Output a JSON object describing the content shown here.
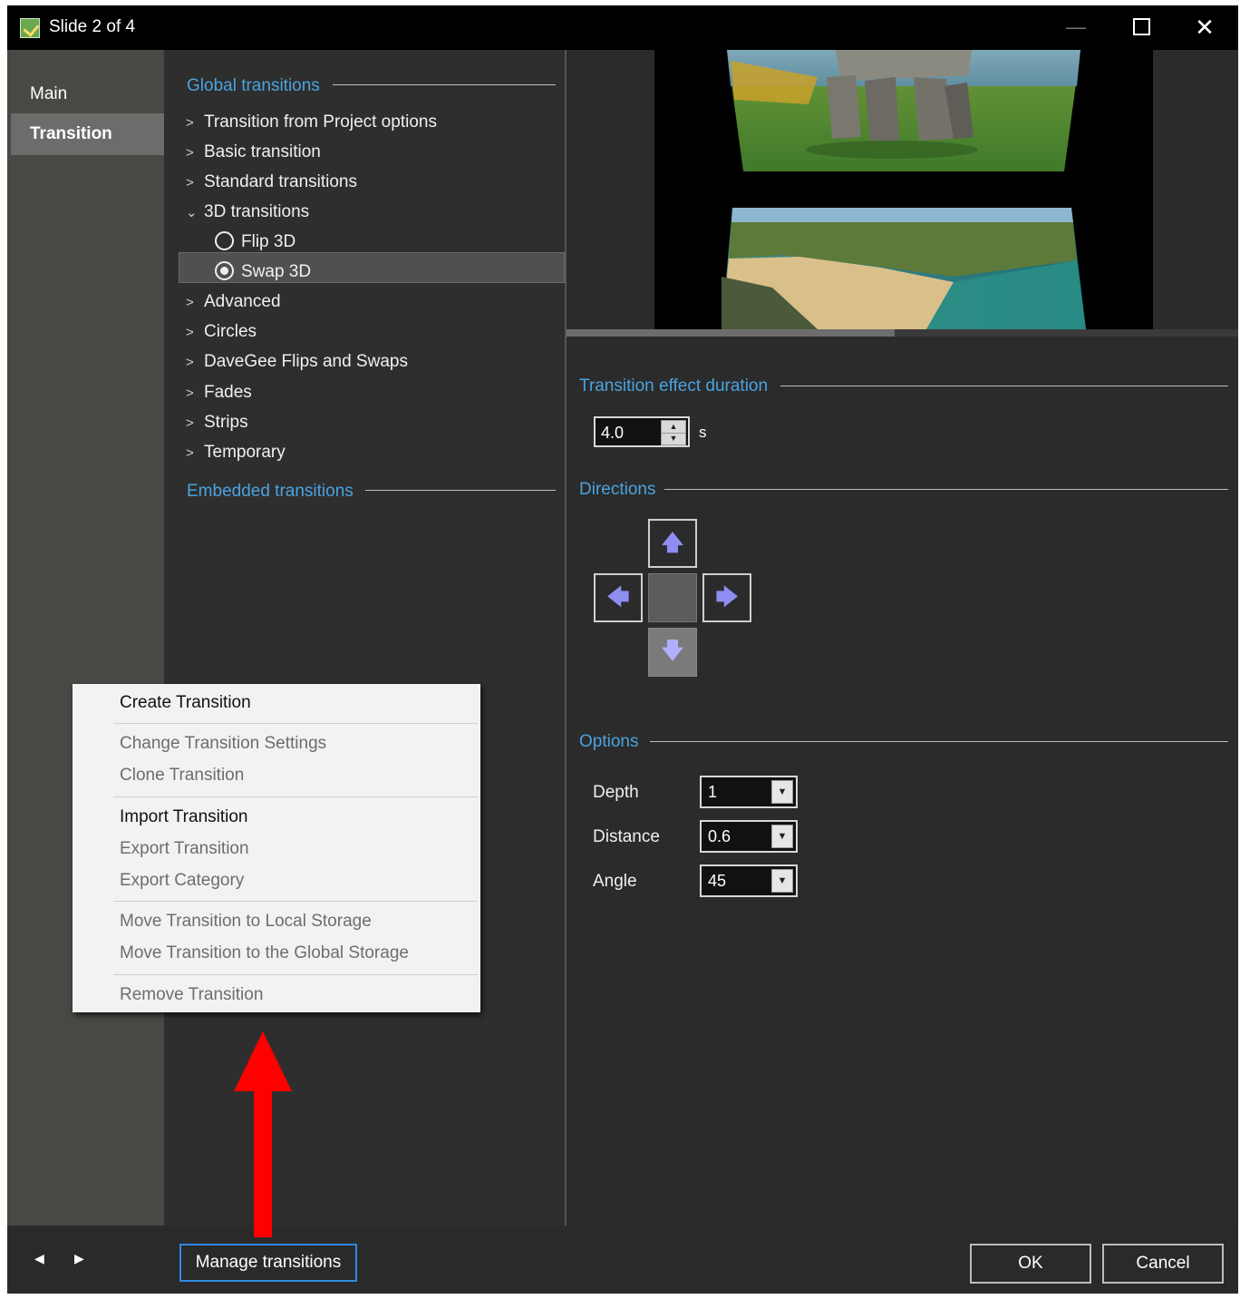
{
  "window": {
    "title": "Slide 2 of 4",
    "minimize": "—",
    "maximize": "",
    "close": "✕"
  },
  "leftnav": {
    "items": [
      {
        "label": "Main"
      },
      {
        "label": "Transition"
      }
    ]
  },
  "tree": {
    "global_title": "Global transitions",
    "rows": [
      {
        "label": "Transition from Project options",
        "chevron": ">"
      },
      {
        "label": "Basic transition",
        "chevron": ">"
      },
      {
        "label": "Standard transitions",
        "chevron": ">"
      },
      {
        "label": "3D transitions",
        "chevron": "⌄"
      },
      {
        "label": "Advanced",
        "chevron": ">"
      },
      {
        "label": "Circles",
        "chevron": ">"
      },
      {
        "label": "DaveGee Flips and Swaps",
        "chevron": ">"
      },
      {
        "label": "Fades",
        "chevron": ">"
      },
      {
        "label": "Strips",
        "chevron": ">"
      },
      {
        "label": "Temporary",
        "chevron": ">"
      }
    ],
    "radios": [
      {
        "label": "Flip 3D",
        "checked": false
      },
      {
        "label": "Swap 3D",
        "checked": true
      }
    ],
    "embedded_title": "Embedded transitions"
  },
  "settings": {
    "duration_title": "Transition effect duration",
    "duration_value": "4.0",
    "duration_unit": "s",
    "directions_title": "Directions",
    "directions": {
      "up": "🡅",
      "left": "🡄",
      "right": "🡆",
      "down": "🡇"
    },
    "options_title": "Options",
    "options": [
      {
        "label": "Depth",
        "value": "1"
      },
      {
        "label": "Distance",
        "value": "0.6"
      },
      {
        "label": "Angle",
        "value": "45"
      }
    ]
  },
  "context_menu": {
    "items": [
      {
        "label": "Create Transition",
        "enabled": true
      },
      {
        "label": "Change Transition Settings",
        "enabled": false
      },
      {
        "label": "Clone Transition",
        "enabled": false
      },
      {
        "label": "Import Transition",
        "enabled": true
      },
      {
        "label": "Export Transition",
        "enabled": false
      },
      {
        "label": "Export Category",
        "enabled": false
      },
      {
        "label": "Move Transition to Local Storage",
        "enabled": false
      },
      {
        "label": "Move Transition to the Global Storage",
        "enabled": false
      },
      {
        "label": "Remove Transition",
        "enabled": false
      }
    ]
  },
  "bottom": {
    "prev": "◀",
    "next": "▶",
    "manage_label": "Manage transitions",
    "ok_label": "OK",
    "cancel_label": "Cancel"
  },
  "colors": {
    "accent": "#4aa3df",
    "focus_border": "#2f8ae5",
    "annotation": "#ff0000"
  }
}
